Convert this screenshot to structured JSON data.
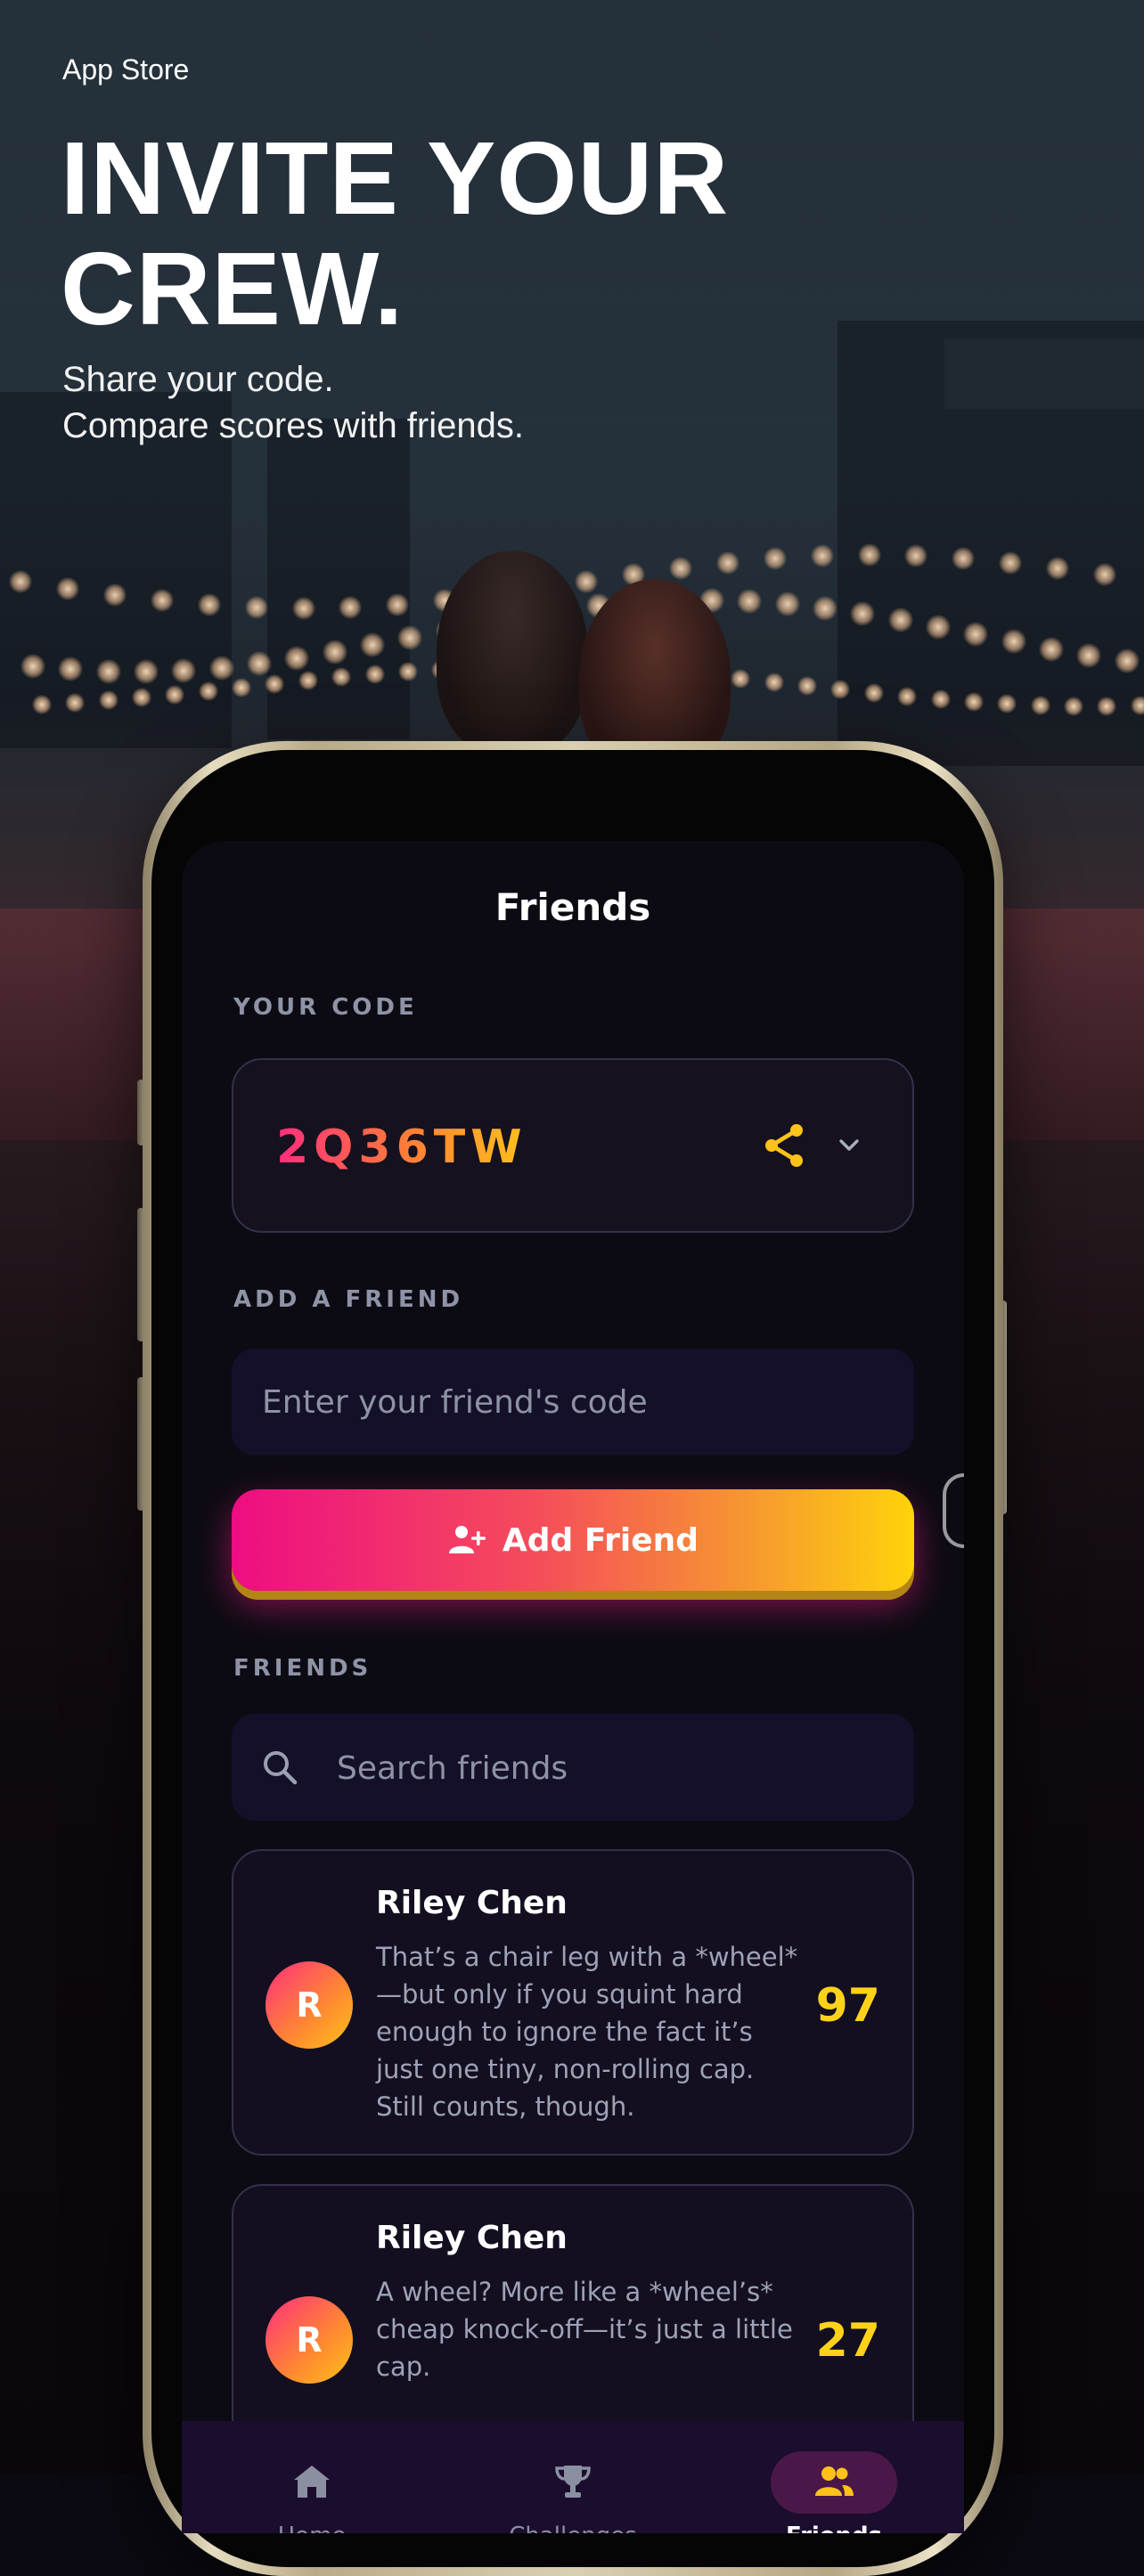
{
  "store_label": "App Store",
  "headline": [
    "INVITE YOUR",
    "CREW."
  ],
  "subline": [
    "Share your code.",
    "Compare scores with friends."
  ],
  "screen": {
    "title": "Friends",
    "your_code_label": "YOUR CODE",
    "code": "2Q36TW",
    "add_friend_label": "ADD A FRIEND",
    "friend_code_placeholder": "Enter your friend's code",
    "add_friend_button": "Add Friend",
    "friends_label": "FRIENDS",
    "search_placeholder": "Search friends",
    "friends": [
      {
        "initial": "R",
        "name": "Riley Chen",
        "message": "That’s a chair leg with a *wheel*—but only if you squint hard enough to ignore the fact it’s just one tiny, non-rolling cap. Still counts, though.",
        "score": "97"
      },
      {
        "initial": "R",
        "name": "Riley Chen",
        "message": "A wheel? More like a *wheel’s* cheap knock-off—it’s just a little cap.",
        "score": "27"
      }
    ]
  },
  "tabbar": {
    "tabs": [
      {
        "label": "Home",
        "icon": "home-icon",
        "active": false
      },
      {
        "label": "Challenges",
        "icon": "trophy-icon",
        "active": false
      },
      {
        "label": "Friends",
        "icon": "users-icon",
        "active": true
      }
    ]
  },
  "colors": {
    "accent_pink": "#ee0d82",
    "accent_yellow": "#ffd30a",
    "score_yellow": "#ffd21a",
    "screen_bg": "#0c0b14",
    "tabbar_bg": "#1b0d2e"
  }
}
